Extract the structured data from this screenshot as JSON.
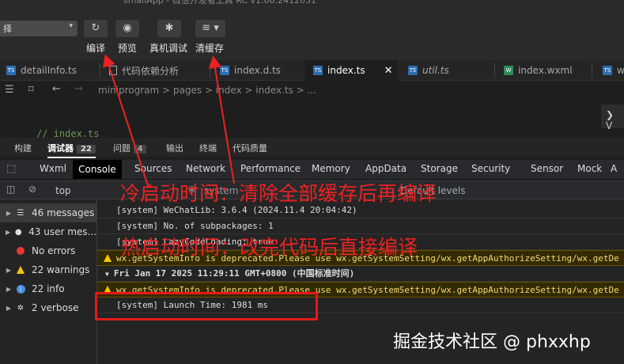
{
  "toolbar": {
    "app_title": "smallApp - 微信开发者工具 RC v1.06.2412031",
    "mode_value": "择",
    "buttons": [
      {
        "label": "编译",
        "icon": "refresh-icon"
      },
      {
        "label": "预览",
        "icon": "eye-icon"
      },
      {
        "label": "真机调试",
        "icon": "bug-icon"
      },
      {
        "label": "清缓存",
        "icon": "layers-icon"
      }
    ]
  },
  "tabs": [
    "detailInfo.ts",
    "代码依赖分析",
    "index.d.ts",
    "index.ts",
    "util.ts",
    "index.wxml",
    "w"
  ],
  "breadcrumb": {
    "parts": [
      "miniprogram",
      ">",
      "pages",
      ">",
      "index",
      ">",
      "index.ts",
      ">",
      "..."
    ],
    "text": "miniprogram > pages > index > index.ts > ..."
  },
  "editor": {
    "comment": "// index.ts"
  },
  "panel_tabs": [
    {
      "label": "构建"
    },
    {
      "label": "调试器",
      "badge": "22"
    },
    {
      "label": "问题",
      "badge": "4"
    },
    {
      "label": "输出"
    },
    {
      "label": "终端"
    },
    {
      "label": "代码质量"
    }
  ],
  "devtools_tabs": [
    "Wxml",
    "Console",
    "Sources",
    "Network",
    "Performance",
    "Memory",
    "AppData",
    "Storage",
    "Security",
    "Sensor",
    "Mock",
    "A"
  ],
  "filter": {
    "context": "top",
    "filter_placeholder": "system",
    "levels": "Default levels"
  },
  "sidebar": [
    {
      "label": "46 messages",
      "icon": "list-icon"
    },
    {
      "label": "43 user mes...",
      "icon": "user-icon"
    },
    {
      "label": "No errors",
      "icon": "error-icon"
    },
    {
      "label": "22 warnings",
      "icon": "warning-icon"
    },
    {
      "label": "22 info",
      "icon": "info-icon"
    },
    {
      "label": "2 verbose",
      "icon": "verbose-icon"
    }
  ],
  "console": [
    {
      "text": "[system] WeChatLib: 3.6.4 (2024.11.4 20:04:42)",
      "type": "log"
    },
    {
      "text": "[system] No. of subpackages: 1",
      "type": "log"
    },
    {
      "text": "[system] LazyCodeLoading: true",
      "type": "log"
    },
    {
      "text": "wx.getSystemInfo is deprecated.Please use wx.getSystemSetting/wx.getAppAuthorizeSetting/wx.getDe",
      "type": "warn"
    },
    {
      "text": "Fri Jan 17 2025 11:29:11 GMT+0800 (中国标准时间)",
      "type": "group"
    },
    {
      "text": "wx.getSystemInfo is deprecated.Please use wx.getSystemSetting/wx.getAppAuthorizeSetting/wx.getDe",
      "type": "warn"
    },
    {
      "text": "[system] Launch Time: 1981 ms",
      "type": "log"
    }
  ],
  "annotations": {
    "cold_start": "冷启动时间：清除全部缓存后再编译",
    "hot_start": "热启动时间：改完代码后直接编译",
    "color": "#ee2222"
  },
  "watermark": "掘金技术社区 @ phxxhp"
}
